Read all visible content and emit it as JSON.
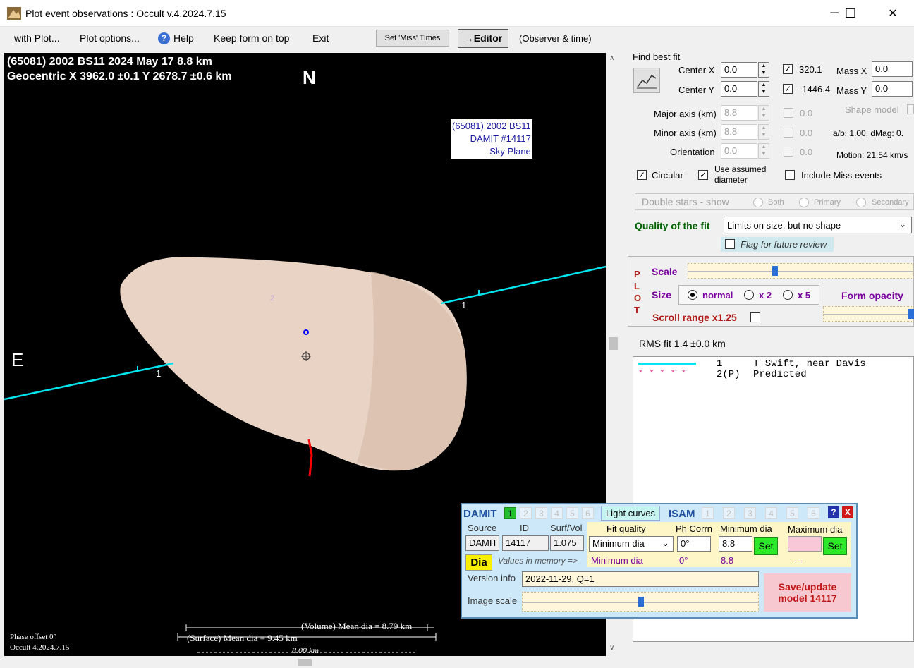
{
  "window": {
    "title": "Plot event observations : Occult v.4.2024.7.15",
    "min": "─",
    "max": "☐",
    "close": "✕"
  },
  "menu": {
    "with_plot": "with Plot...",
    "plot_options": "Plot options...",
    "help": "Help",
    "keep_on_top": "Keep form on top",
    "exit": "Exit",
    "set_miss": "Set 'Miss' Times",
    "editor": "→Editor",
    "observer_time": "(Observer & time)"
  },
  "plot": {
    "line1": "(65081) 2002 BS11  2024 May 17   8.8 km",
    "line2": "Geocentric  X  3962.0 ±0.1  Y 2678.7 ±0.6 km",
    "north": "N",
    "east": "E",
    "label_box": [
      "(65081) 2002 BS11",
      "DAMIT #14117",
      "Sky Plane"
    ],
    "chord_label_left": "1",
    "chord_label_right": "1",
    "pred_label": "2",
    "phase": "Phase offset 0°",
    "occult_version": "Occult 4.2024.7.15",
    "vol_dia": "(Volume) Mean dia = 8.79 km",
    "surf_dia": "(Surface) Mean dia = 9.45 km",
    "scale_len": "8.00 km",
    "colors": {
      "chord": "#00e5f0",
      "shape": "#e9d3c4",
      "limb": "#ff0000"
    }
  },
  "fit": {
    "title": "Find best fit",
    "center_x_label": "Center X",
    "center_x": "0.0",
    "center_y_label": "Center Y",
    "center_y": "0.0",
    "cx_val": "320.1",
    "cy_val": "-1446.4",
    "mass_x_label": "Mass X",
    "mass_x": "0.0",
    "mass_y_label": "Mass Y",
    "mass_y": "0.0",
    "major_label": "Major axis (km)",
    "major": "8.8",
    "minor_label": "Minor axis (km)",
    "minor": "8.8",
    "orient_label": "Orientation",
    "orient": "0.0",
    "d1": "0.0",
    "d2": "0.0",
    "d3": "0.0",
    "shape_model": "Shape model",
    "ab": "a/b: 1.00, dMag: 0.",
    "motion": "Motion: 21.54 km/s",
    "circular": "Circular",
    "use_assumed": "Use assumed diameter",
    "include_miss": "Include Miss events",
    "double_stars": "Double stars - show",
    "both": "Both",
    "primary": "Primary",
    "secondary": "Secondary",
    "quality_label": "Quality of the fit",
    "quality_value": "Limits on size, but no shape",
    "flag": "Flag for future review"
  },
  "plotpanel": {
    "side": [
      "P",
      "L",
      "O",
      "T"
    ],
    "scale": "Scale",
    "size": "Size",
    "normal": "normal",
    "x2": "x 2",
    "x5": "x 5",
    "form_opacity": "Form opacity",
    "scroll_range": "Scroll range x1.25",
    "scale_pos": 0.38
  },
  "rms": "RMS fit  1.4 ±0.0 km",
  "legend": {
    "rows": [
      {
        "num": "1",
        "name": "T Swift, near Davis"
      },
      {
        "num": "2(P)",
        "name": "Predicted"
      }
    ]
  },
  "damit": {
    "damit_label": "DAMIT",
    "nums": [
      "1",
      "2",
      "3",
      "4",
      "5",
      "6"
    ],
    "light_curves": "Light curves",
    "isam_label": "ISAM",
    "isam_nums": [
      "1",
      "2",
      "3",
      "4",
      "5",
      "6"
    ],
    "help": "?",
    "close": "X",
    "source_label": "Source",
    "id_label": "ID",
    "surf_label": "Surf/Vol",
    "fit_quality_label": "Fit quality",
    "ph_corr_label": "Ph Corrn",
    "min_dia_label": "Minimum dia",
    "max_dia_label": "Maximum dia",
    "source": "DAMIT",
    "id": "14117",
    "surf": "1.075",
    "fit_quality": "Minimum dia",
    "ph_corr": "0°",
    "min_dia": "8.8",
    "set": "Set",
    "dia": "Dia",
    "values_mem": "Values in memory =>",
    "mem_fit": "Minimum dia",
    "mem_ph": "0°",
    "mem_min": "8.8",
    "mem_max": "----",
    "version_label": "Version info",
    "version": "2022-11-29, Q=1",
    "image_scale": "Image scale",
    "save": "Save/update model 14117",
    "image_scale_pos": 0.5
  }
}
